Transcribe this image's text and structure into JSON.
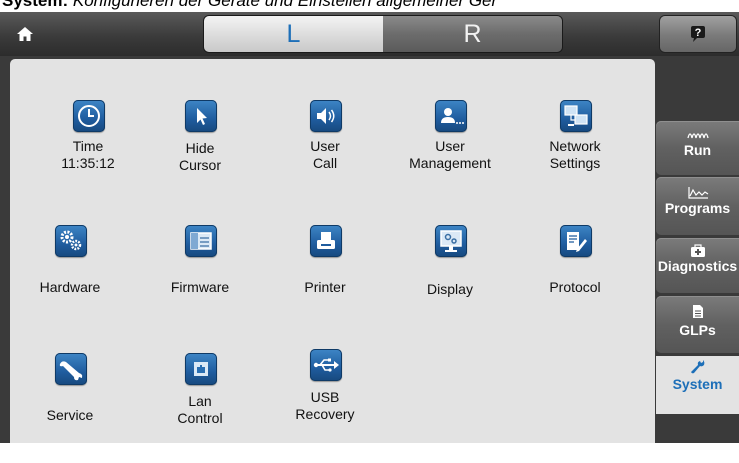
{
  "caption": {
    "prefix": "System:",
    "text": "Konfigurieren der Geräte und Einstellen allgemeiner Ger"
  },
  "topbar": {
    "left_label": "L",
    "right_label": "R"
  },
  "tiles": [
    {
      "icon": "clock-icon",
      "line1": "Time",
      "line2": "11:35:12"
    },
    {
      "icon": "cursor-icon",
      "line1": "Hide",
      "line2": "Cursor"
    },
    {
      "icon": "speaker-icon",
      "line1": "User",
      "line2": "Call"
    },
    {
      "icon": "user-icon",
      "line1": "User",
      "line2": "Management"
    },
    {
      "icon": "network-icon",
      "line1": "Network",
      "line2": "Settings"
    },
    {
      "icon": "gears-icon",
      "line1": "Hardware",
      "line2": ""
    },
    {
      "icon": "chip-icon",
      "line1": "Firmware",
      "line2": ""
    },
    {
      "icon": "printer-icon",
      "line1": "Printer",
      "line2": ""
    },
    {
      "icon": "monitor-icon",
      "line1": "Display",
      "line2": ""
    },
    {
      "icon": "document-edit-icon",
      "line1": "Protocol",
      "line2": ""
    },
    {
      "icon": "wrench-icon",
      "line1": "Service",
      "line2": ""
    },
    {
      "icon": "lan-icon",
      "line1": "Lan",
      "line2": "Control"
    },
    {
      "icon": "usb-icon",
      "line1": "USB",
      "line2": "Recovery"
    }
  ],
  "side_tabs": [
    {
      "icon": "waveform-icon",
      "label": "Run"
    },
    {
      "icon": "chart-icon",
      "label": "Programs"
    },
    {
      "icon": "first-aid-icon",
      "label": "Diagnostics"
    },
    {
      "icon": "document-icon",
      "label": "GLPs"
    },
    {
      "icon": "wrench-icon",
      "label": "System",
      "active": true
    }
  ],
  "colors": {
    "accent": "#1d6fb8",
    "panel": "#e3e3e3",
    "chrome": "#3a3a3a",
    "icon_tile": "#2a6fb2"
  }
}
